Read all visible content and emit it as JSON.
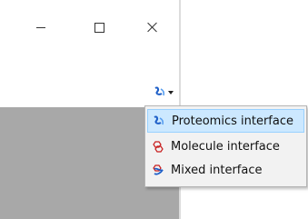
{
  "window": {
    "controls": {
      "minimize_icon": "minimize-icon",
      "maximize_icon": "maximize-icon",
      "close_icon": "close-icon"
    }
  },
  "interface_switcher": {
    "icon": "proteomics-interface-icon",
    "menu": {
      "items": [
        {
          "label": "Proteomics interface",
          "icon": "proteomics-icon",
          "selected": true
        },
        {
          "label": "Molecule interface",
          "icon": "molecule-icon",
          "selected": false
        },
        {
          "label": "Mixed interface",
          "icon": "mixed-icon",
          "selected": false
        }
      ]
    }
  },
  "colors": {
    "selection_bg": "#cce8ff",
    "selection_border": "#99d1ff",
    "workspace": "#a8a8a8",
    "menu_bg": "#f2f2f2",
    "proteomics_blue": "#1e5fc8",
    "molecule_red": "#c81e1e"
  }
}
